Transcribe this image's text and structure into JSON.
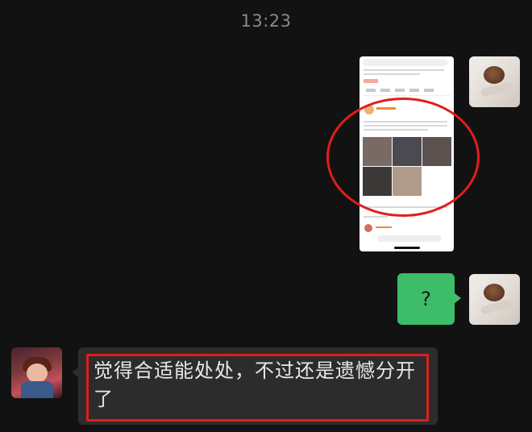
{
  "chat": {
    "timestamp": "13:23",
    "messages": [
      {
        "sender": "self",
        "type": "image",
        "content": "screenshot"
      },
      {
        "sender": "self",
        "type": "text",
        "text": "?"
      },
      {
        "sender": "other",
        "type": "text",
        "text": "觉得合适能处处，不过还是遗憾分开了"
      }
    ]
  },
  "colors": {
    "background": "#121212",
    "sent_bubble": "#3dbc69",
    "received_bubble": "#2c2c2c",
    "annotation": "#e01e1e"
  }
}
